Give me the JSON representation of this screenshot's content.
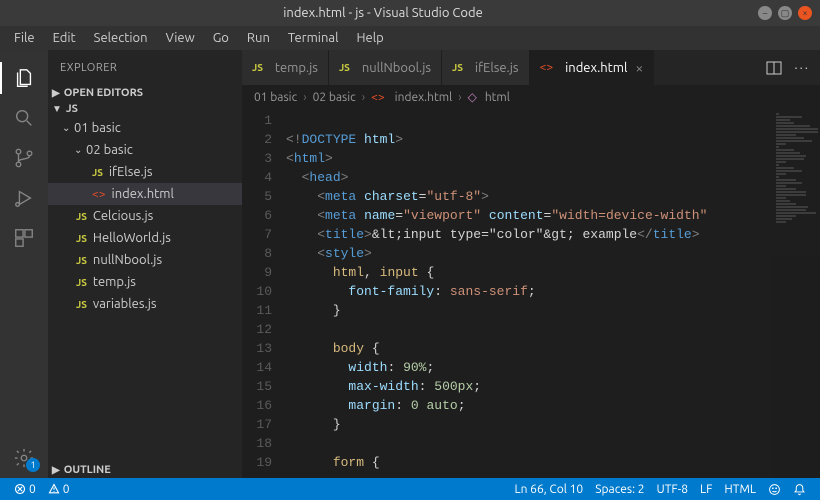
{
  "title": "index.html - js - Visual Studio Code",
  "menu": [
    "File",
    "Edit",
    "Selection",
    "View",
    "Go",
    "Run",
    "Terminal",
    "Help"
  ],
  "sidebar": {
    "title": "EXPLORER",
    "sections": {
      "openEditors": "OPEN EDITORS",
      "root": "JS",
      "outline": "OUTLINE"
    },
    "tree": {
      "folder1": "01 basic",
      "folder2": "02 basic",
      "files_inner": [
        "ifElse.js",
        "index.html"
      ],
      "files_root": [
        "Celcious.js",
        "HelloWorld.js",
        "nullNbool.js",
        "temp.js",
        "variables.js"
      ]
    }
  },
  "activity_badge": "1",
  "tabs": [
    {
      "label": "temp.js",
      "active": false,
      "icon": "js"
    },
    {
      "label": "nullNbool.js",
      "active": false,
      "icon": "js"
    },
    {
      "label": "ifElse.js",
      "active": false,
      "icon": "js"
    },
    {
      "label": "index.html",
      "active": true,
      "icon": "html"
    }
  ],
  "breadcrumbs": [
    "01 basic",
    "02 basic",
    "index.html",
    "html"
  ],
  "code_lines": [
    "",
    "<!DOCTYPE html>",
    "<html>",
    "  <head>",
    "    <meta charset=\"utf-8\">",
    "    <meta name=\"viewport\" content=\"width=device-width\"",
    "    <title>&lt;input type=\"color\"&gt; example</title>",
    "    <style>",
    "      html, input {",
    "        font-family: sans-serif;",
    "      }",
    "",
    "      body {",
    "        width: 90%;",
    "        max-width: 500px;",
    "        margin: 0 auto;",
    "      }",
    "",
    "      form {"
  ],
  "status": {
    "errors": "0",
    "warnings": "0",
    "lncol": "Ln 66, Col 10",
    "spaces": "Spaces: 2",
    "encoding": "UTF-8",
    "eol": "LF",
    "lang": "HTML"
  }
}
